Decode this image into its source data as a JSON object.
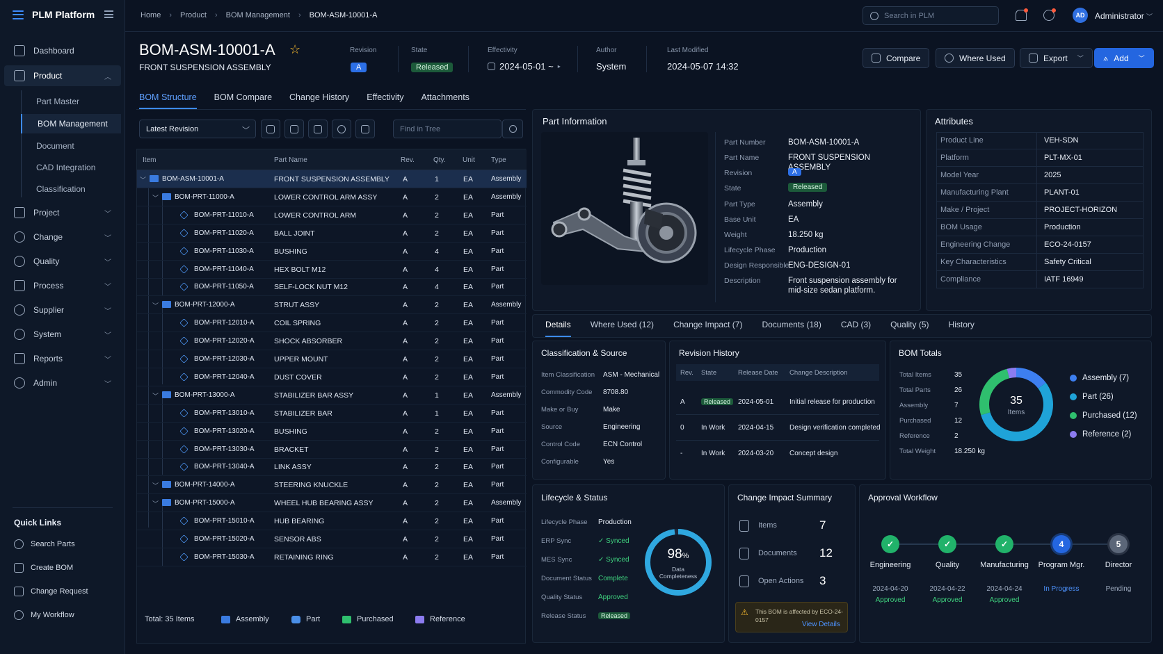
{
  "app": {
    "name": "PLM Platform"
  },
  "sidebar": {
    "items": [
      {
        "label": "Dashboard"
      },
      {
        "label": "Product"
      },
      {
        "label": "Project"
      },
      {
        "label": "Change"
      },
      {
        "label": "Quality"
      },
      {
        "label": "Process"
      },
      {
        "label": "Supplier"
      },
      {
        "label": "System"
      },
      {
        "label": "Reports"
      },
      {
        "label": "Admin"
      }
    ],
    "product_sub": [
      "Part Master",
      "BOM Management",
      "Document",
      "CAD Integration",
      "Classification"
    ],
    "quick_links_title": "Quick Links",
    "quick_links": [
      "Search Parts",
      "Create BOM",
      "Change Request",
      "My Workflow"
    ]
  },
  "topbar": {
    "breadcrumb": [
      "Home",
      "Product",
      "BOM Management",
      "BOM-ASM-10001-A"
    ],
    "search_placeholder": "Search in PLM",
    "avatar": "AD",
    "user": "Administrator"
  },
  "header": {
    "title": "BOM-ASM-10001-A",
    "subtitle": "FRONT SUSPENSION ASSEMBLY",
    "revision_label": "Revision",
    "revision": "A",
    "state_label": "State",
    "state": "Released",
    "effectivity_label": "Effectivity",
    "effectivity": "2024-05-01 ~",
    "author_label": "Author",
    "author": "System",
    "modified_label": "Last Modified",
    "modified": "2024-05-07 14:32",
    "buttons": {
      "compare": "Compare",
      "where_used": "Where Used",
      "export": "Export",
      "add": "Add"
    }
  },
  "tabs": [
    "BOM Structure",
    "BOM Compare",
    "Change History",
    "Effectivity",
    "Attachments"
  ],
  "toolbar": {
    "revision_select": "Latest Revision",
    "find_placeholder": "Find in Tree"
  },
  "tree": {
    "columns": [
      "Item",
      "Part Name",
      "Rev.",
      "Qty.",
      "Unit",
      "Type"
    ],
    "rows": [
      {
        "item": "BOM-ASM-10001-A",
        "name": "FRONT SUSPENSION ASSEMBLY",
        "rev": "A",
        "qty": "1",
        "unit": "EA",
        "type": "Assembly"
      },
      {
        "item": "BOM-PRT-11000-A",
        "name": "LOWER CONTROL ARM ASSY",
        "rev": "A",
        "qty": "2",
        "unit": "EA",
        "type": "Assembly"
      },
      {
        "item": "BOM-PRT-11010-A",
        "name": "LOWER CONTROL ARM",
        "rev": "A",
        "qty": "2",
        "unit": "EA",
        "type": "Part"
      },
      {
        "item": "BOM-PRT-11020-A",
        "name": "BALL JOINT",
        "rev": "A",
        "qty": "2",
        "unit": "EA",
        "type": "Part"
      },
      {
        "item": "BOM-PRT-11030-A",
        "name": "BUSHING",
        "rev": "A",
        "qty": "4",
        "unit": "EA",
        "type": "Part"
      },
      {
        "item": "BOM-PRT-11040-A",
        "name": "HEX BOLT M12",
        "rev": "A",
        "qty": "4",
        "unit": "EA",
        "type": "Part"
      },
      {
        "item": "BOM-PRT-11050-A",
        "name": "SELF-LOCK NUT M12",
        "rev": "A",
        "qty": "4",
        "unit": "EA",
        "type": "Part"
      },
      {
        "item": "BOM-PRT-12000-A",
        "name": "STRUT ASSY",
        "rev": "A",
        "qty": "2",
        "unit": "EA",
        "type": "Assembly"
      },
      {
        "item": "BOM-PRT-12010-A",
        "name": "COIL SPRING",
        "rev": "A",
        "qty": "2",
        "unit": "EA",
        "type": "Part"
      },
      {
        "item": "BOM-PRT-12020-A",
        "name": "SHOCK ABSORBER",
        "rev": "A",
        "qty": "2",
        "unit": "EA",
        "type": "Part"
      },
      {
        "item": "BOM-PRT-12030-A",
        "name": "UPPER MOUNT",
        "rev": "A",
        "qty": "2",
        "unit": "EA",
        "type": "Part"
      },
      {
        "item": "BOM-PRT-12040-A",
        "name": "DUST COVER",
        "rev": "A",
        "qty": "2",
        "unit": "EA",
        "type": "Part"
      },
      {
        "item": "BOM-PRT-13000-A",
        "name": "STABILIZER BAR ASSY",
        "rev": "A",
        "qty": "1",
        "unit": "EA",
        "type": "Assembly"
      },
      {
        "item": "BOM-PRT-13010-A",
        "name": "STABILIZER BAR",
        "rev": "A",
        "qty": "1",
        "unit": "EA",
        "type": "Part"
      },
      {
        "item": "BOM-PRT-13020-A",
        "name": "BUSHING",
        "rev": "A",
        "qty": "2",
        "unit": "EA",
        "type": "Part"
      },
      {
        "item": "BOM-PRT-13030-A",
        "name": "BRACKET",
        "rev": "A",
        "qty": "2",
        "unit": "EA",
        "type": "Part"
      },
      {
        "item": "BOM-PRT-13040-A",
        "name": "LINK ASSY",
        "rev": "A",
        "qty": "2",
        "unit": "EA",
        "type": "Part"
      },
      {
        "item": "BOM-PRT-14000-A",
        "name": "STEERING KNUCKLE",
        "rev": "A",
        "qty": "2",
        "unit": "EA",
        "type": "Part"
      },
      {
        "item": "BOM-PRT-15000-A",
        "name": "WHEEL HUB BEARING ASSY",
        "rev": "A",
        "qty": "2",
        "unit": "EA",
        "type": "Assembly"
      },
      {
        "item": "BOM-PRT-15010-A",
        "name": "HUB BEARING",
        "rev": "A",
        "qty": "2",
        "unit": "EA",
        "type": "Part"
      },
      {
        "item": "BOM-PRT-15020-A",
        "name": "SENSOR ABS",
        "rev": "A",
        "qty": "2",
        "unit": "EA",
        "type": "Part"
      },
      {
        "item": "BOM-PRT-15030-A",
        "name": "RETAINING RING",
        "rev": "A",
        "qty": "2",
        "unit": "EA",
        "type": "Part"
      }
    ],
    "footer": {
      "total": "Total: 35 Items",
      "legend": [
        "Assembly",
        "Part",
        "Purchased",
        "Reference"
      ]
    }
  },
  "part_info": {
    "title": "Part Information",
    "fields": [
      {
        "label": "Part Number",
        "value": "BOM-ASM-10001-A"
      },
      {
        "label": "Part Name",
        "value": "FRONT SUSPENSION ASSEMBLY"
      },
      {
        "label": "Revision",
        "value": "A"
      },
      {
        "label": "State",
        "value": "Released"
      },
      {
        "label": "Part Type",
        "value": "Assembly"
      },
      {
        "label": "Base Unit",
        "value": "EA"
      },
      {
        "label": "Weight",
        "value": "18.250 kg"
      },
      {
        "label": "Lifecycle Phase",
        "value": "Production"
      },
      {
        "label": "Design Responsible",
        "value": "ENG-DESIGN-01"
      },
      {
        "label": "Description",
        "value": "Front suspension assembly for mid-size sedan platform."
      }
    ]
  },
  "attributes": {
    "title": "Attributes",
    "rows": [
      {
        "label": "Product Line",
        "value": "VEH-SDN"
      },
      {
        "label": "Platform",
        "value": "PLT-MX-01"
      },
      {
        "label": "Model Year",
        "value": "2025"
      },
      {
        "label": "Manufacturing Plant",
        "value": "PLANT-01"
      },
      {
        "label": "Make / Project",
        "value": "PROJECT-HORIZON"
      },
      {
        "label": "BOM Usage",
        "value": "Production"
      },
      {
        "label": "Engineering Change",
        "value": "ECO-24-0157"
      },
      {
        "label": "Key Characteristics",
        "value": "Safety Critical"
      },
      {
        "label": "Compliance",
        "value": "IATF 16949"
      }
    ]
  },
  "detail_tabs": [
    "Details",
    "Where Used (12)",
    "Change Impact (7)",
    "Documents (18)",
    "CAD (3)",
    "Quality (5)",
    "History"
  ],
  "classification": {
    "title": "Classification & Source",
    "rows": [
      {
        "label": "Item Classification",
        "value": "ASM - Mechanical"
      },
      {
        "label": "Commodity Code",
        "value": "8708.80"
      },
      {
        "label": "Make or Buy",
        "value": "Make"
      },
      {
        "label": "Source",
        "value": "Engineering"
      },
      {
        "label": "Control Code",
        "value": "ECN Control"
      },
      {
        "label": "Configurable",
        "value": "Yes"
      }
    ]
  },
  "revision_history": {
    "title": "Revision History",
    "columns": [
      "Rev.",
      "State",
      "Release Date",
      "Change Description"
    ],
    "rows": [
      {
        "rev": "A",
        "state": "Released",
        "date": "2024-05-01",
        "desc": "Initial release for production"
      },
      {
        "rev": "0",
        "state": "In Work",
        "date": "2024-04-15",
        "desc": "Design verification completed"
      },
      {
        "rev": "-",
        "state": "In Work",
        "date": "2024-03-20",
        "desc": "Concept design"
      }
    ]
  },
  "bom_totals": {
    "title": "BOM Totals",
    "rows": [
      {
        "label": "Total Items",
        "value": "35"
      },
      {
        "label": "Total Parts",
        "value": "26"
      },
      {
        "label": "Assembly",
        "value": "7"
      },
      {
        "label": "Purchased",
        "value": "12"
      },
      {
        "label": "Reference",
        "value": "2"
      },
      {
        "label": "Total Weight",
        "value": "18.250 kg"
      }
    ],
    "donut_center": "35",
    "donut_sub": "Items",
    "legend": [
      "Assembly (7)",
      "Part (26)",
      "Purchased (12)",
      "Reference (2)"
    ],
    "colors": [
      "#3d7ff0",
      "#1fa3d8",
      "#2fbf6e",
      "#8c7cf0"
    ],
    "counts": [
      7,
      26,
      12,
      2
    ]
  },
  "lifecycle": {
    "title": "Lifecycle & Status",
    "rows": [
      {
        "label": "Lifecycle Phase",
        "value": "Production"
      },
      {
        "label": "ERP Sync",
        "value": "✓ Synced"
      },
      {
        "label": "MES Sync",
        "value": "✓ Synced"
      },
      {
        "label": "Document Status",
        "value": "Complete"
      },
      {
        "label": "Quality Status",
        "value": "Approved"
      },
      {
        "label": "Release Status",
        "value": "Released"
      }
    ],
    "gauge_value": "98",
    "gauge_pct": "%",
    "gauge_label1": "Data",
    "gauge_label2": "Completeness",
    "gauge_fraction": 0.98
  },
  "change_impact": {
    "title": "Change Impact Summary",
    "rows": [
      {
        "label": "Items",
        "value": "7"
      },
      {
        "label": "Documents",
        "value": "12"
      },
      {
        "label": "Open Actions",
        "value": "3"
      }
    ],
    "notice": "This BOM is affected by ECO-24-0157",
    "notice_link": "View Details"
  },
  "approval": {
    "title": "Approval Workflow",
    "steps": [
      {
        "label": "Engineering",
        "date": "2024-04-20",
        "status": "Approved",
        "mark": "✓"
      },
      {
        "label": "Quality",
        "date": "2024-04-22",
        "status": "Approved",
        "mark": "✓"
      },
      {
        "label": "Manufacturing",
        "date": "2024-04-24",
        "status": "Approved",
        "mark": "✓"
      },
      {
        "label": "Program Mgr.",
        "date": "",
        "status": "In Progress",
        "mark": "4"
      },
      {
        "label": "Director",
        "date": "",
        "status": "Pending",
        "mark": "5"
      }
    ]
  }
}
